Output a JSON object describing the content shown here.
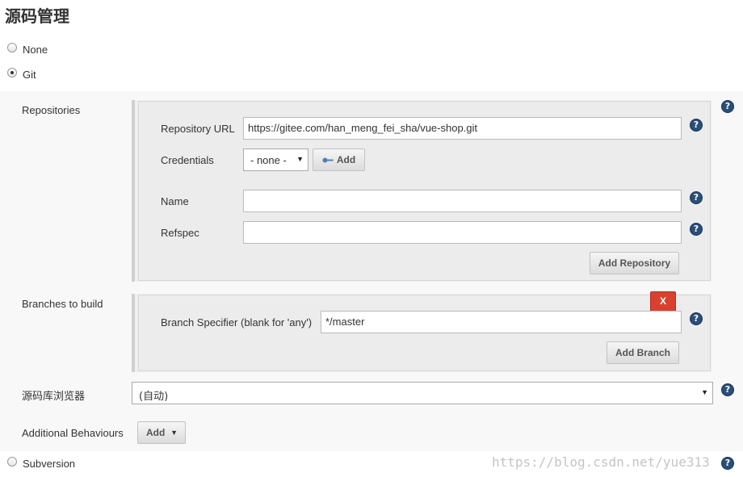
{
  "section_title": "源码管理",
  "scm_options": {
    "none_label": "None",
    "git_label": "Git",
    "subversion_label": "Subversion",
    "selected": "Git"
  },
  "repositories": {
    "label": "Repositories",
    "url_label": "Repository URL",
    "url_value": "https://gitee.com/han_meng_fei_sha/vue-shop.git",
    "credentials_label": "Credentials",
    "credentials_value": "- none -",
    "credentials_add_label": "Add",
    "name_label": "Name",
    "name_value": "",
    "refspec_label": "Refspec",
    "refspec_value": "",
    "add_repository_label": "Add Repository"
  },
  "branches": {
    "label": "Branches to build",
    "delete_label": "X",
    "specifier_label": "Branch Specifier (blank for 'any')",
    "specifier_value": "*/master",
    "add_branch_label": "Add Branch"
  },
  "repo_browser": {
    "label": "源码库浏览器",
    "value": "(自动)"
  },
  "additional_behaviours": {
    "label": "Additional Behaviours",
    "add_label": "Add"
  },
  "help_glyph": "?",
  "watermark": "https://blog.csdn.net/yue313",
  "colors": {
    "help_icon": "#2a4e78",
    "delete_button": "#d9412e",
    "panel_background": "#ececec"
  }
}
